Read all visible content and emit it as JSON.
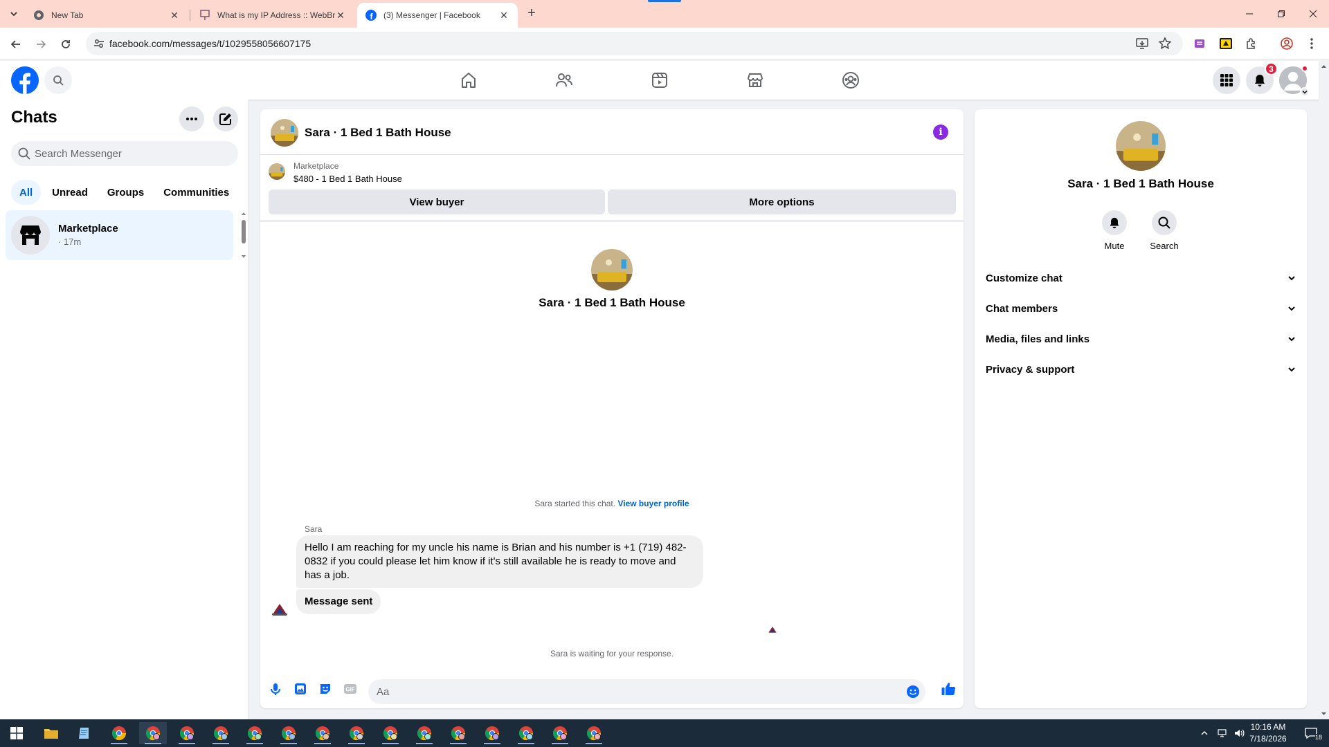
{
  "browser": {
    "tabs": [
      {
        "title": "New Tab",
        "active": false
      },
      {
        "title": "What is my IP Address :: WebBr",
        "active": false
      },
      {
        "title": "(3) Messenger | Facebook",
        "active": true
      }
    ],
    "url": "facebook.com/messages/t/1029558056607175"
  },
  "fb": {
    "notification_count": "3"
  },
  "chats": {
    "title": "Chats",
    "search_placeholder": "Search Messenger",
    "filters": [
      "All",
      "Unread",
      "Groups",
      "Communities"
    ],
    "active_filter": "All",
    "items": [
      {
        "name": "Marketplace",
        "time": "· 17m"
      }
    ]
  },
  "conversation": {
    "title": "Sara · 1 Bed 1 Bath House",
    "marketplace_label": "Marketplace",
    "listing": "$480 - 1 Bed 1 Bath House",
    "view_buyer": "View buyer",
    "more_options": "More options",
    "intro_name": "Sara · 1 Bed 1 Bath House",
    "started_text": "Sara started this chat.",
    "buyer_profile_link": "View buyer profile",
    "sender": "Sara",
    "messages": [
      "Hello I am reaching for my uncle his name is Brian and his number is +1 (719) 482-0832 if you could please let him know if it's still available he is ready to move and has a job.",
      "Message sent"
    ],
    "waiting_text": "Sara is waiting for your response.",
    "composer_placeholder": "Aa"
  },
  "info_panel": {
    "name": "Sara · 1 Bed 1 Bath House",
    "actions": [
      "Mute",
      "Search"
    ],
    "sections": [
      "Customize chat",
      "Chat members",
      "Media, files and links",
      "Privacy & support"
    ]
  },
  "taskbar": {
    "time": "10:16 AM",
    "date": "7/18/2026",
    "notification_count": "18"
  },
  "colors": {
    "brand_blue": "#0866ff",
    "active_chat_bg": "#ebf5ff",
    "tab_strip": "#fcd8cf",
    "info_purple": "#8a2be2"
  }
}
